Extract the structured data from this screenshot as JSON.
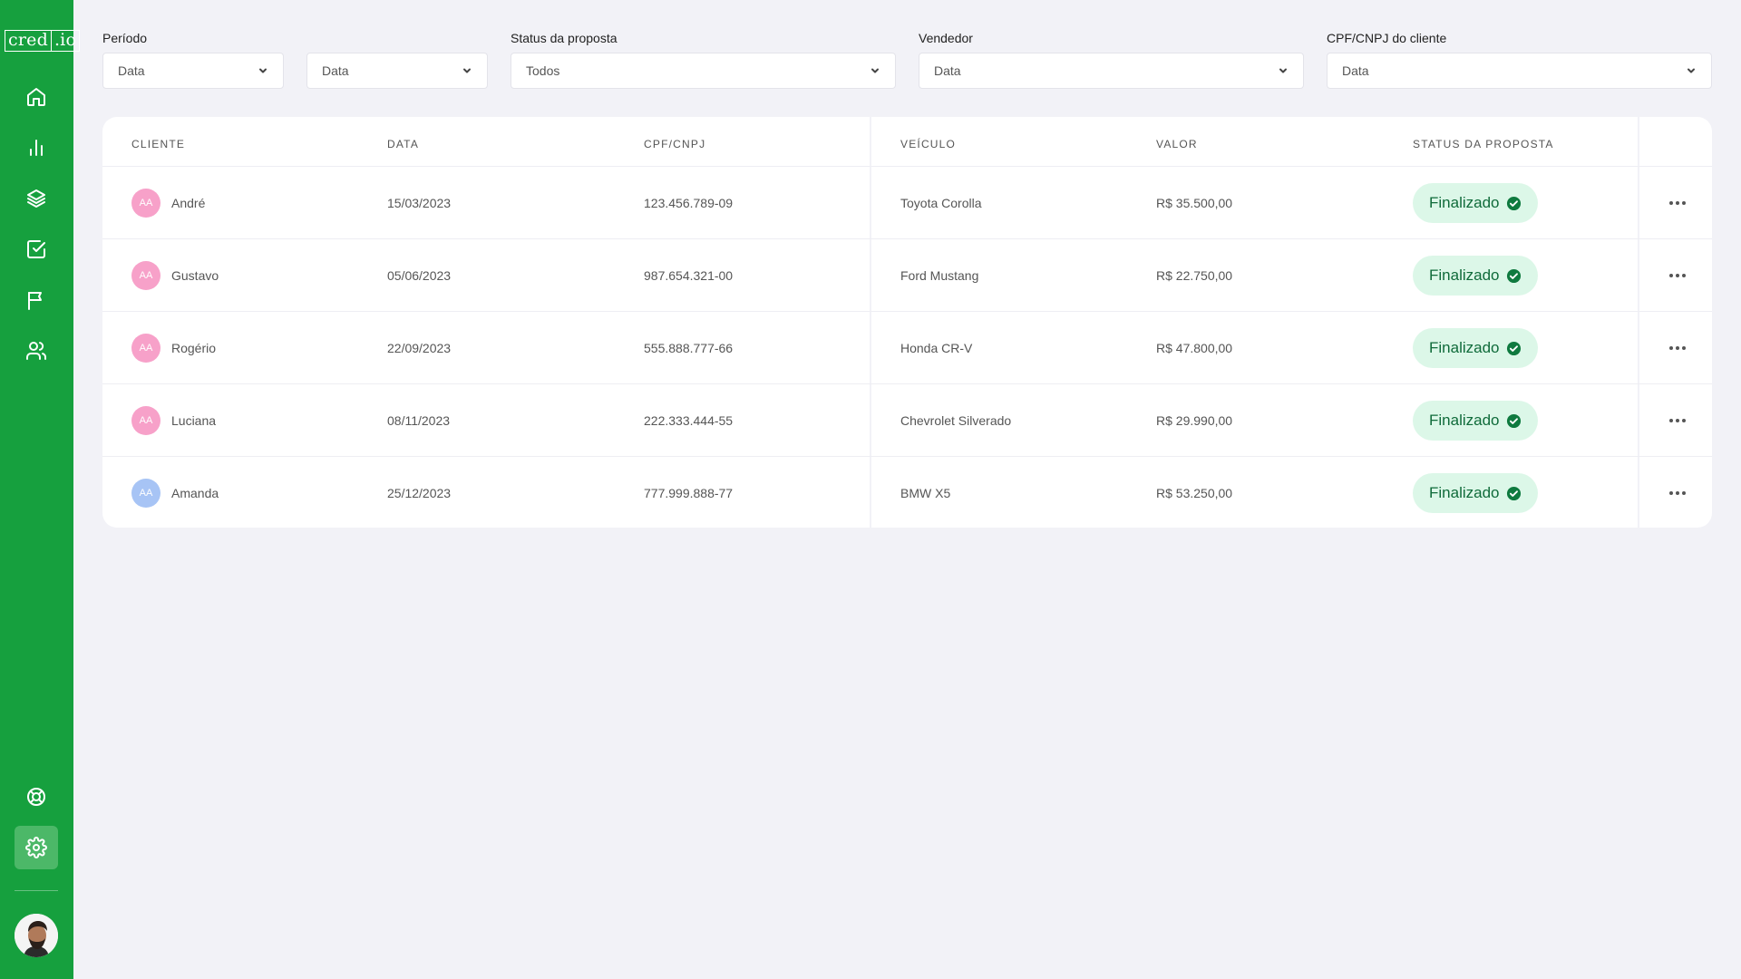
{
  "brand": {
    "part1": "cred",
    "part2": ".io"
  },
  "nav": [
    {
      "icon": "home-icon"
    },
    {
      "icon": "bar-chart-icon"
    },
    {
      "icon": "layers-icon"
    },
    {
      "icon": "check-square-icon"
    },
    {
      "icon": "flag-icon"
    },
    {
      "icon": "users-icon"
    }
  ],
  "nav_bottom": [
    {
      "icon": "life-buoy-icon"
    },
    {
      "icon": "settings-icon",
      "active": true
    }
  ],
  "filters": {
    "periodo": {
      "label": "Período",
      "start_value": "Data",
      "end_value": "Data"
    },
    "status": {
      "label": "Status da proposta",
      "value": "Todos"
    },
    "vendedor": {
      "label": "Vendedor",
      "value": "Data"
    },
    "cpf": {
      "label": "CPF/CNPJ do cliente",
      "value": "Data"
    }
  },
  "table": {
    "headers": {
      "cliente": "Cliente",
      "data": "Data",
      "cpf": "CPF/CNPJ",
      "veiculo": "Veículo",
      "valor": "Valor",
      "status": "Status da proposta"
    },
    "rows": [
      {
        "initials": "AA",
        "avatar_color": "#f7a1c9",
        "name": "André",
        "date": "15/03/2023",
        "doc": "123.456.789-09",
        "vehicle": "Toyota Corolla",
        "value": "R$ 35.500,00",
        "status": "Finalizado"
      },
      {
        "initials": "AA",
        "avatar_color": "#f7a1c9",
        "name": "Gustavo",
        "date": "05/06/2023",
        "doc": "987.654.321-00",
        "vehicle": "Ford Mustang",
        "value": "R$ 22.750,00",
        "status": "Finalizado"
      },
      {
        "initials": "AA",
        "avatar_color": "#f7a1c9",
        "name": "Rogério",
        "date": "22/09/2023",
        "doc": "555.888.777-66",
        "vehicle": "Honda CR-V",
        "value": "R$ 47.800,00",
        "status": "Finalizado"
      },
      {
        "initials": "AA",
        "avatar_color": "#f7a1c9",
        "name": "Luciana",
        "date": "08/11/2023",
        "doc": "222.333.444-55",
        "vehicle": "Chevrolet Silverado",
        "value": "R$ 29.990,00",
        "status": "Finalizado"
      },
      {
        "initials": "AA",
        "avatar_color": "#a7c4f5",
        "name": "Amanda",
        "date": "25/12/2023",
        "doc": "777.999.888-77",
        "vehicle": "BMW X5",
        "value": "R$ 53.250,00",
        "status": "Finalizado"
      }
    ]
  },
  "colors": {
    "sidebar": "#16a03e",
    "badge_bg": "#dcf7e8",
    "badge_text": "#0f6b3a",
    "badge_icon": "#0f7a3f"
  }
}
